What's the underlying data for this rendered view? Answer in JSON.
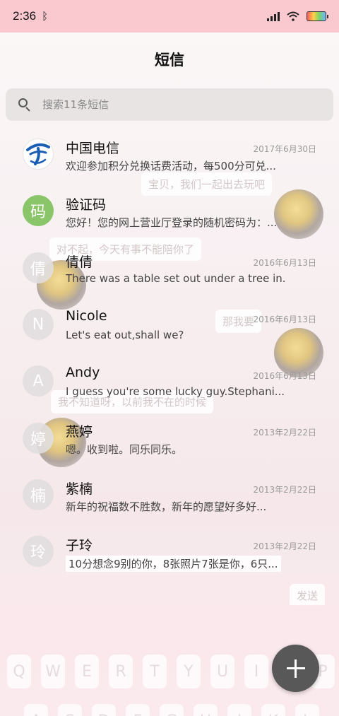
{
  "status_bar": {
    "time": "2:36",
    "icons": [
      "bluetooth-icon",
      "signal-icon",
      "wifi-icon",
      "battery-icon"
    ]
  },
  "header": {
    "title": "短信"
  },
  "search": {
    "placeholder": "搜索11条短信"
  },
  "conversations": [
    {
      "name": "中国电信",
      "date": "2017年6月30日",
      "preview": "欢迎参加积分兑换话费活动，每500分可兑...",
      "avatar_text": "",
      "avatar_type": "logo"
    },
    {
      "name": "验证码",
      "date": "",
      "preview": "您好！您的网上营业厅登录的随机密码为：...",
      "avatar_text": "码",
      "avatar_type": "green"
    },
    {
      "name": "倩倩",
      "date": "2016年6月13日",
      "preview": "There was a table set out under a tree in...",
      "avatar_text": "倩",
      "avatar_type": "grey"
    },
    {
      "name": "Nicole",
      "date": "2016年6月13日",
      "preview": "Let's eat out,shall we?",
      "avatar_text": "N",
      "avatar_type": "grey"
    },
    {
      "name": "Andy",
      "date": "2016年6月13日",
      "preview": "I guess you're some lucky guy.Stephani...",
      "avatar_text": "A",
      "avatar_type": "grey"
    },
    {
      "name": "燕婷",
      "date": "2013年2月22日",
      "preview": "嗯。收到啦。同乐同乐。",
      "avatar_text": "婷",
      "avatar_type": "grey"
    },
    {
      "name": "紫楠",
      "date": "2013年2月22日",
      "preview": "新年的祝福数不胜数，新年的愿望好多好...",
      "avatar_text": "楠",
      "avatar_type": "grey"
    },
    {
      "name": "子玲",
      "date": "2013年2月22日",
      "preview": "10分想念9别的你，8张照片7张是你，6只...",
      "avatar_text": "玲",
      "avatar_type": "grey"
    }
  ],
  "wallpaper": {
    "bubbles": [
      "宝贝，我们一起出去玩吧",
      "对不起，今天有事不能陪你了",
      "那我要",
      "我不知道呀，以前我不在的时候",
      "发送"
    ],
    "keys": [
      "Q",
      "W",
      "E",
      "R",
      "T",
      "Y",
      "U",
      "I",
      "O",
      "P",
      "A",
      "S",
      "D",
      "F",
      "G",
      "H",
      "J",
      "K",
      "L"
    ]
  },
  "fab": {
    "icon": "plus-icon"
  },
  "colors": {
    "status_bar": "#f9c9cf",
    "fab": "#585858",
    "avatar_green": "#8bc56a",
    "brand_blue": "#1b5fb5"
  }
}
